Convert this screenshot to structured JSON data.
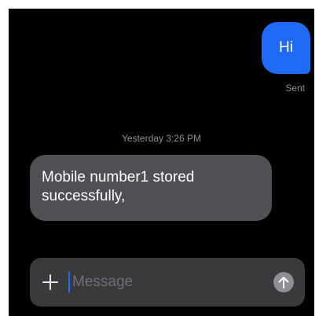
{
  "conversation": {
    "sent_message": {
      "text": "Hi",
      "status": "Sent"
    },
    "timestamp": "Yesterday 3:26 PM",
    "received_message": {
      "text": "Mobile number1 stored successfully,"
    }
  },
  "composer": {
    "placeholder": "Message",
    "add_icon": "plus-icon",
    "send_icon": "arrow-up-icon"
  },
  "colors": {
    "sent_bubble": "#1f6bf5",
    "received_bubble": "#505054",
    "background": "#000000",
    "composer": "#3a3a3c"
  }
}
